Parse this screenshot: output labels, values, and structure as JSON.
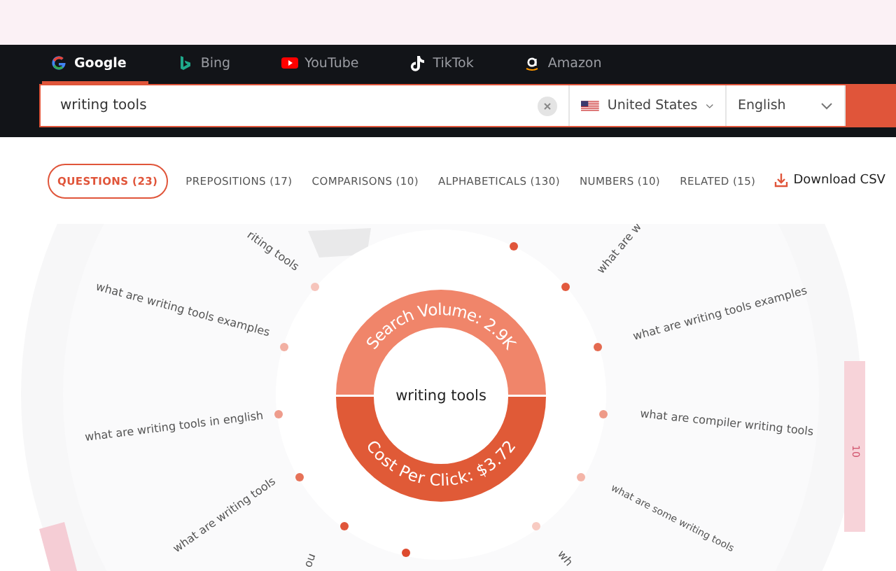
{
  "engine_tabs": [
    {
      "label": "Google",
      "kind": "google",
      "selected": true
    },
    {
      "label": "Bing",
      "kind": "bing",
      "selected": false
    },
    {
      "label": "YouTube",
      "kind": "youtube",
      "selected": false
    },
    {
      "label": "TikTok",
      "kind": "tiktok",
      "selected": false
    },
    {
      "label": "Amazon",
      "kind": "amazon",
      "selected": false
    }
  ],
  "search": {
    "value": "writing tools",
    "country": "United States",
    "language": "English"
  },
  "filters": [
    {
      "label": "QUESTIONS (23)",
      "selected": true
    },
    {
      "label": "PREPOSITIONS (17)",
      "selected": false
    },
    {
      "label": "COMPARISONS (10)",
      "selected": false
    },
    {
      "label": "ALPHABETICALS (130)",
      "selected": false
    },
    {
      "label": "NUMBERS (10)",
      "selected": false
    },
    {
      "label": "RELATED (15)",
      "selected": false
    }
  ],
  "download": "Download CSV",
  "wheel": {
    "keyword": "writing tools",
    "search_volume": "Search Volume: 2.9K",
    "cost_per_click": "Cost Per Click: $3.72",
    "group_count": "10",
    "questions": [
      "riting tools",
      "what are writing tools examples",
      "what are writing tools in english",
      "what are writing tools",
      "ou",
      "what are w",
      "what are writing tools examples",
      "what are compiler writing tools",
      "what are some writing tools",
      "wh"
    ]
  }
}
